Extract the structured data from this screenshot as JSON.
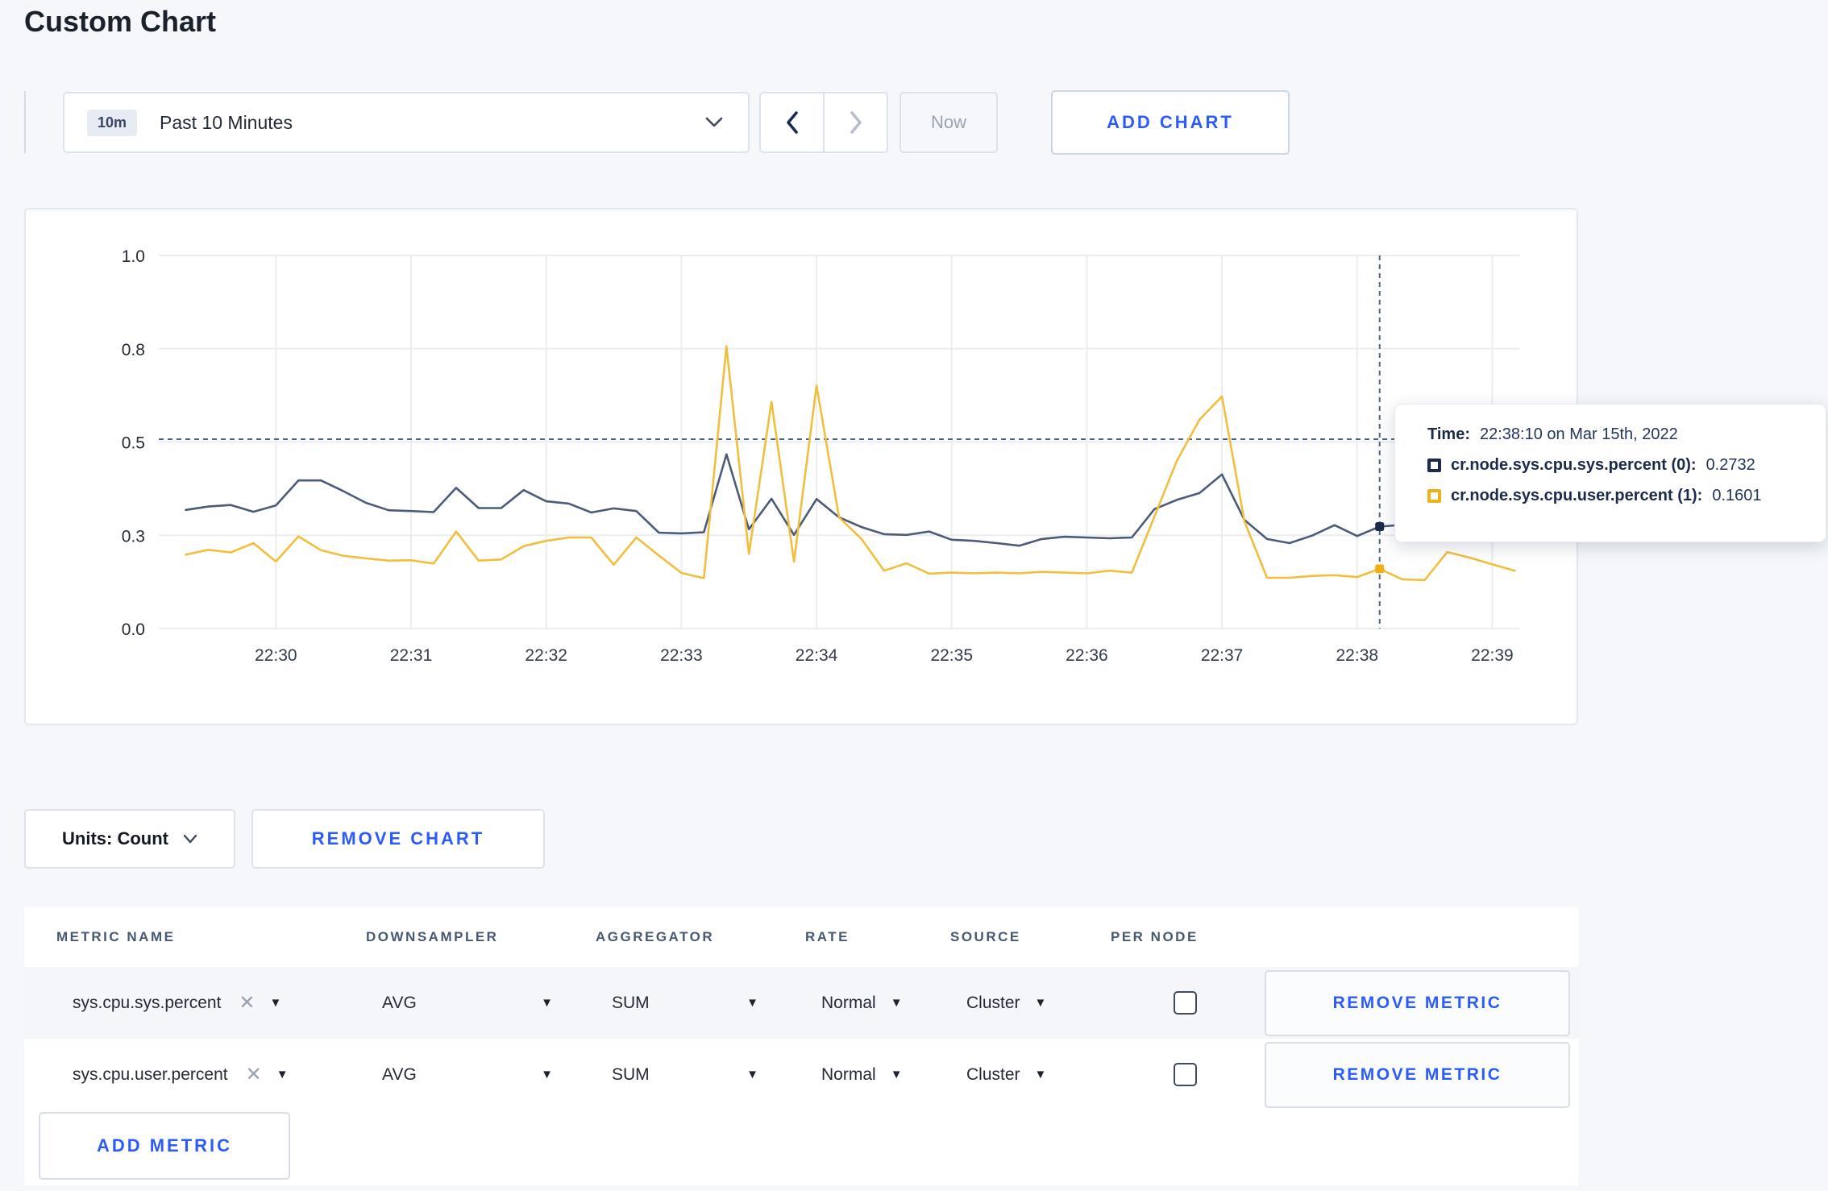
{
  "page": {
    "title": "Custom Chart",
    "background": "#f5f7fa",
    "accent_blue": "#2b5bfb"
  },
  "toolbar": {
    "time_window_badge": "10m",
    "time_window_label": "Past 10 Minutes",
    "prev_label": "previous time window",
    "next_label": "next time window",
    "now_label": "Now",
    "add_chart_label": "ADD CHART"
  },
  "chart_data": {
    "type": "line",
    "title": "",
    "xlabel": "",
    "ylabel": "",
    "x_axis": {
      "window_start": "22:29:08",
      "window_end": "22:39:12",
      "domain_offsets_s": [
        8,
        612
      ],
      "ticks": [
        {
          "offset_s": 60,
          "label": "22:30"
        },
        {
          "offset_s": 120,
          "label": "22:31"
        },
        {
          "offset_s": 180,
          "label": "22:32"
        },
        {
          "offset_s": 240,
          "label": "22:33"
        },
        {
          "offset_s": 300,
          "label": "22:34"
        },
        {
          "offset_s": 360,
          "label": "22:35"
        },
        {
          "offset_s": 420,
          "label": "22:36"
        },
        {
          "offset_s": 480,
          "label": "22:37"
        },
        {
          "offset_s": 540,
          "label": "22:38"
        },
        {
          "offset_s": 600,
          "label": "22:39"
        }
      ]
    },
    "y_axis": {
      "range": [
        0,
        1
      ],
      "grid": true,
      "ticks": [
        {
          "value": 0.0,
          "label": "0.0"
        },
        {
          "value": 0.25,
          "label": "0.3"
        },
        {
          "value": 0.5,
          "label": "0.5"
        },
        {
          "value": 0.75,
          "label": "0.8"
        },
        {
          "value": 1.0,
          "label": "1.0"
        }
      ]
    },
    "sample_interval_s": 10,
    "first_sample_offset_s": 20,
    "series": [
      {
        "name": "cr.node.sys.cpu.sys.percent (0)",
        "color": "#4c5b78",
        "swatch": "#1c2b4a",
        "values": [
          0.318,
          0.327,
          0.331,
          0.313,
          0.33,
          0.397,
          0.397,
          0.368,
          0.337,
          0.317,
          0.315,
          0.312,
          0.377,
          0.323,
          0.323,
          0.371,
          0.341,
          0.335,
          0.311,
          0.322,
          0.315,
          0.257,
          0.255,
          0.258,
          0.467,
          0.266,
          0.348,
          0.251,
          0.347,
          0.298,
          0.272,
          0.253,
          0.251,
          0.26,
          0.238,
          0.235,
          0.229,
          0.222,
          0.24,
          0.246,
          0.244,
          0.242,
          0.244,
          0.32,
          0.345,
          0.363,
          0.413,
          0.291,
          0.24,
          0.229,
          0.249,
          0.277,
          0.248,
          0.2732,
          0.278,
          0.298,
          0.285,
          0.3,
          0.295,
          0.31
        ]
      },
      {
        "name": "cr.node.sys.cpu.user.percent (1)",
        "color": "#f1bf3d",
        "swatch": "#f0b118",
        "values": [
          0.198,
          0.211,
          0.204,
          0.229,
          0.18,
          0.247,
          0.21,
          0.195,
          0.188,
          0.182,
          0.183,
          0.174,
          0.26,
          0.182,
          0.185,
          0.221,
          0.235,
          0.244,
          0.244,
          0.171,
          0.244,
          0.196,
          0.149,
          0.135,
          0.757,
          0.2,
          0.608,
          0.179,
          0.651,
          0.298,
          0.24,
          0.155,
          0.175,
          0.147,
          0.15,
          0.148,
          0.15,
          0.148,
          0.152,
          0.15,
          0.148,
          0.155,
          0.15,
          0.3,
          0.45,
          0.56,
          0.622,
          0.287,
          0.136,
          0.136,
          0.141,
          0.143,
          0.138,
          0.1601,
          0.132,
          0.13,
          0.205,
          0.19,
          0.172,
          0.155
        ]
      }
    ],
    "crosshair": {
      "time_offset_s": 550,
      "hline_value": 0.5075,
      "color": "#4f6780"
    },
    "grid_color": "#ebedf0",
    "tick_text_color": "#242b36",
    "legend_position": "tooltip"
  },
  "tooltip": {
    "time_label": "Time:",
    "time_value": "22:38:10 on Mar 15th, 2022",
    "series": [
      {
        "label": "cr.node.sys.cpu.sys.percent (0):",
        "value": "0.2732"
      },
      {
        "label": "cr.node.sys.cpu.user.percent (1):",
        "value": "0.1601"
      }
    ]
  },
  "chart_controls": {
    "units_label": "Units: Count",
    "remove_chart_label": "REMOVE CHART"
  },
  "metrics_table": {
    "headers": [
      "METRIC NAME",
      "DOWNSAMPLER",
      "AGGREGATOR",
      "RATE",
      "SOURCE",
      "PER NODE"
    ],
    "rows": [
      {
        "metric_name": "sys.cpu.sys.percent",
        "downsampler": "AVG",
        "aggregator": "SUM",
        "rate": "Normal",
        "source": "Cluster",
        "per_node_checked": false,
        "remove_label": "REMOVE METRIC"
      },
      {
        "metric_name": "sys.cpu.user.percent",
        "downsampler": "AVG",
        "aggregator": "SUM",
        "rate": "Normal",
        "source": "Cluster",
        "per_node_checked": false,
        "remove_label": "REMOVE METRIC"
      }
    ],
    "add_metric_label": "ADD METRIC"
  }
}
